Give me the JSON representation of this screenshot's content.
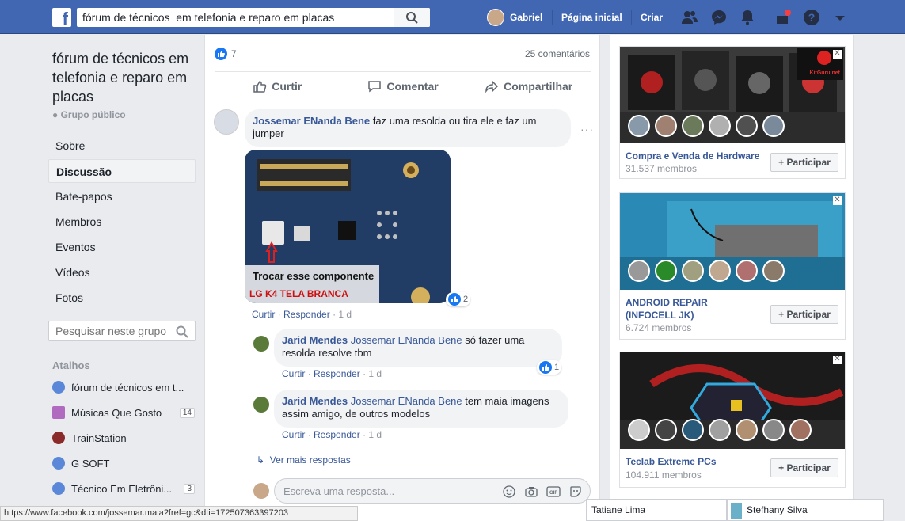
{
  "topbar": {
    "search_value": "fórum de técnicos  em telefonia e reparo em placas",
    "user_name": "Gabriel",
    "home": "Página inicial",
    "create": "Criar"
  },
  "group": {
    "title": "fórum de técnicos em telefonia e reparo em placas",
    "privacy": "Grupo público",
    "menu": [
      "Sobre",
      "Discussão",
      "Bate-papos",
      "Membros",
      "Eventos",
      "Vídeos",
      "Fotos"
    ],
    "search_placeholder": "Pesquisar neste grupo",
    "shortcuts_title": "Atalhos",
    "shortcuts": [
      {
        "label": "fórum de técnicos em t...",
        "badge": ""
      },
      {
        "label": "Músicas Que Gosto",
        "badge": "14"
      },
      {
        "label": "TrainStation",
        "badge": ""
      },
      {
        "label": "G SOFT",
        "badge": ""
      },
      {
        "label": "Técnico Em Eletrôni...",
        "badge": "3"
      }
    ]
  },
  "post": {
    "likes": "7",
    "comments_count": "25 comentários",
    "like": "Curtir",
    "comment": "Comentar",
    "share": "Compartilhar"
  },
  "comments": [
    {
      "author": "Jossemar ENanda Bene",
      "text": "faz uma resolda ou tira ele e faz um jumper",
      "image_caption": "Trocar esse componente",
      "image_label": "LG K4 TELA BRANCA",
      "reactions": "2",
      "like": "Curtir",
      "reply": "Responder",
      "time": "1 d"
    },
    {
      "author": "Jarid Mendes",
      "tag": "Jossemar ENanda Bene",
      "text": "só fazer uma resolda resolve tbm",
      "reactions": "1",
      "like": "Curtir",
      "reply": "Responder",
      "time": "1 d"
    },
    {
      "author": "Jarid Mendes",
      "tag": "Jossemar ENanda Bene",
      "text": "tem maia imagens assim amigo, de outros modelos",
      "like": "Curtir",
      "reply": "Responder",
      "time": "1 d"
    }
  ],
  "more_replies": "Ver mais respostas",
  "reply_placeholder": "Escreva uma resposta...",
  "suggestions": [
    {
      "name": "Compra e Venda de Hardware",
      "members": "31.537 membros",
      "join": "Participar",
      "watermark": "KitGuru.net"
    },
    {
      "name": "ANDROID REPAIR (INFOCELL JK)",
      "members": "6.724 membros",
      "join": "Participar"
    },
    {
      "name": "Teclab Extreme PCs",
      "members": "104.911 membros",
      "join": "Participar"
    }
  ],
  "chat": [
    "Tatiane Lima",
    "Stefhany Silva"
  ],
  "status_url": "https://www.facebook.com/jossemar.maia?fref=gc&dti=172507363397203"
}
